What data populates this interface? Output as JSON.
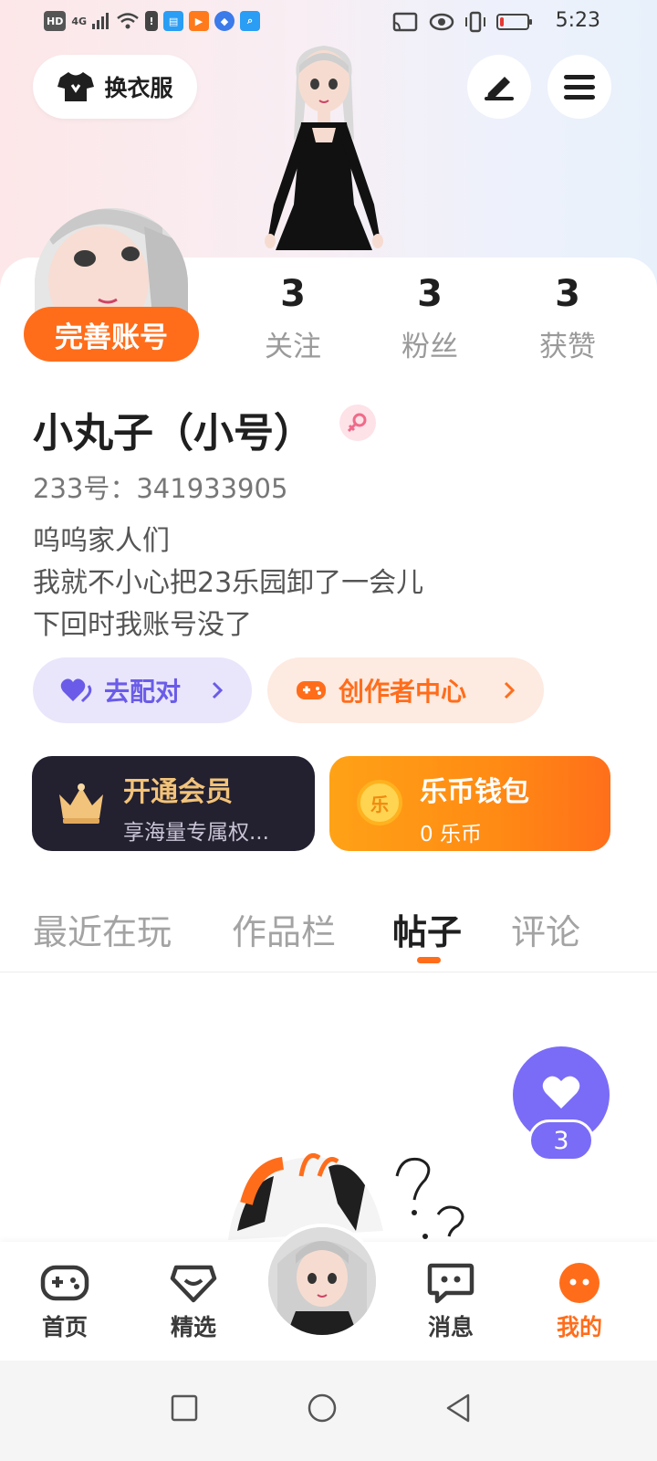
{
  "status_bar": {
    "time": "5:23",
    "left_badges": [
      "HD",
      "4G"
    ],
    "battery_percent": 15,
    "battery_color": "#e53935"
  },
  "header": {
    "outfit_label": "换衣服",
    "edit_icon": "pen-icon",
    "menu_icon": "hamburger-menu-icon"
  },
  "profile": {
    "complete_account_label": "完善账号",
    "username": "小丸子（小号）",
    "gender_icon": "female-gender-icon",
    "uid_text": "233号：341933905",
    "bio_lines": [
      "呜呜家人们",
      "我就不小心把23乐园卸了一会儿",
      "下回时我账号没了"
    ]
  },
  "stats": [
    {
      "value": "3",
      "label": "关注"
    },
    {
      "value": "3",
      "label": "粉丝"
    },
    {
      "value": "3",
      "label": "获赞"
    }
  ],
  "actions": {
    "match_label": "去配对",
    "creator_label": "创作者中心"
  },
  "cards": {
    "vip_title": "开通会员",
    "vip_sub": "享海量专属权...",
    "coin_title": "乐币钱包",
    "coin_sub": "0 乐币",
    "coin_glyph": "乐"
  },
  "tabs": [
    "最近在玩",
    "作品栏",
    "帖子",
    "评论"
  ],
  "active_tab": "帖子",
  "like_fab": {
    "count": "3"
  },
  "bottom_nav": [
    {
      "label": "首页",
      "icon": "gamepad-icon"
    },
    {
      "label": "精选",
      "icon": "heart-chat-icon"
    },
    {
      "label": "消息",
      "icon": "message-bubble-icon"
    },
    {
      "label": "我的",
      "icon": "me-face-icon"
    }
  ],
  "colors": {
    "accent_orange": "#ff6d1b",
    "purple": "#7a6cf7",
    "vip_dark": "#232030",
    "gold": "#f2c37a"
  }
}
